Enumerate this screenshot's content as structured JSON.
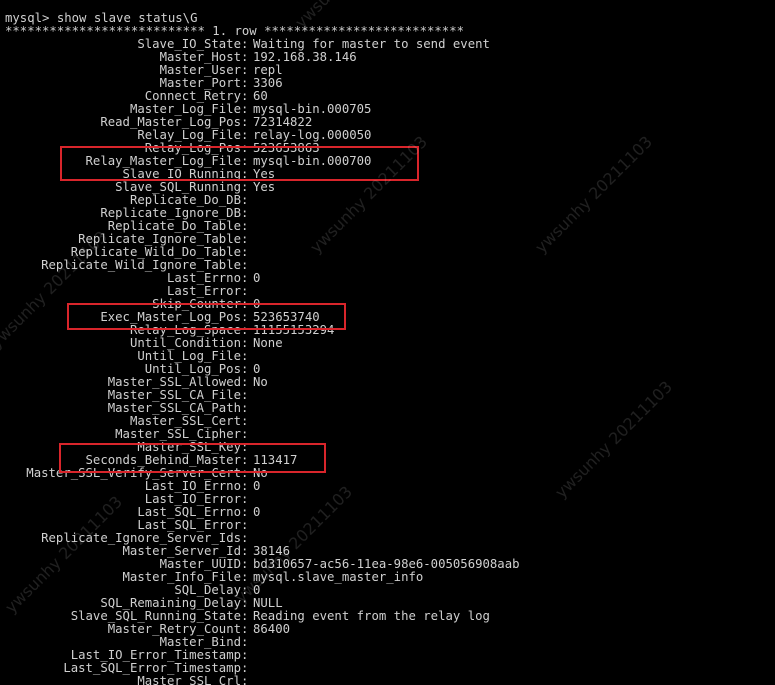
{
  "terminal": {
    "background": "#000000",
    "text_color": "#d0d0d0",
    "highlight_color": "#d9252b",
    "command_line": "mysql> show slave status\\G",
    "row_header": "*************************** 1. row ***************************",
    "fields": [
      {
        "name": "Slave_IO_State",
        "value": "Waiting for master to send event"
      },
      {
        "name": "Master_Host",
        "value": "192.168.38.146"
      },
      {
        "name": "Master_User",
        "value": "repl"
      },
      {
        "name": "Master_Port",
        "value": "3306"
      },
      {
        "name": "Connect_Retry",
        "value": "60"
      },
      {
        "name": "Master_Log_File",
        "value": "mysql-bin.000705"
      },
      {
        "name": "Read_Master_Log_Pos",
        "value": "72314822"
      },
      {
        "name": "Relay_Log_File",
        "value": "relay-log.000050"
      },
      {
        "name": "Relay_Log_Pos",
        "value": "523653863"
      },
      {
        "name": "Relay_Master_Log_File",
        "value": "mysql-bin.000700"
      },
      {
        "name": "Slave_IO_Running",
        "value": "Yes"
      },
      {
        "name": "Slave_SQL_Running",
        "value": "Yes"
      },
      {
        "name": "Replicate_Do_DB",
        "value": ""
      },
      {
        "name": "Replicate_Ignore_DB",
        "value": ""
      },
      {
        "name": "Replicate_Do_Table",
        "value": ""
      },
      {
        "name": "Replicate_Ignore_Table",
        "value": ""
      },
      {
        "name": "Replicate_Wild_Do_Table",
        "value": ""
      },
      {
        "name": "Replicate_Wild_Ignore_Table",
        "value": ""
      },
      {
        "name": "Last_Errno",
        "value": "0"
      },
      {
        "name": "Last_Error",
        "value": ""
      },
      {
        "name": "Skip_Counter",
        "value": "0"
      },
      {
        "name": "Exec_Master_Log_Pos",
        "value": "523653740"
      },
      {
        "name": "Relay_Log_Space",
        "value": "11155153294"
      },
      {
        "name": "Until_Condition",
        "value": "None"
      },
      {
        "name": "Until_Log_File",
        "value": ""
      },
      {
        "name": "Until_Log_Pos",
        "value": "0"
      },
      {
        "name": "Master_SSL_Allowed",
        "value": "No"
      },
      {
        "name": "Master_SSL_CA_File",
        "value": ""
      },
      {
        "name": "Master_SSL_CA_Path",
        "value": ""
      },
      {
        "name": "Master_SSL_Cert",
        "value": ""
      },
      {
        "name": "Master_SSL_Cipher",
        "value": ""
      },
      {
        "name": "Master_SSL_Key",
        "value": ""
      },
      {
        "name": "Seconds_Behind_Master",
        "value": "113417"
      },
      {
        "name": "Master_SSL_Verify_Server_Cert",
        "value": "No"
      },
      {
        "name": "Last_IO_Errno",
        "value": "0"
      },
      {
        "name": "Last_IO_Error",
        "value": ""
      },
      {
        "name": "Last_SQL_Errno",
        "value": "0"
      },
      {
        "name": "Last_SQL_Error",
        "value": ""
      },
      {
        "name": "Replicate_Ignore_Server_Ids",
        "value": ""
      },
      {
        "name": "Master_Server_Id",
        "value": "38146"
      },
      {
        "name": "Master_UUID",
        "value": "bd310657-ac56-11ea-98e6-005056908aab"
      },
      {
        "name": "Master_Info_File",
        "value": "mysql.slave_master_info"
      },
      {
        "name": "SQL_Delay",
        "value": "0"
      },
      {
        "name": "SQL_Remaining_Delay",
        "value": "NULL"
      },
      {
        "name": "Slave_SQL_Running_State",
        "value": "Reading event from the relay log"
      },
      {
        "name": "Master_Retry_Count",
        "value": "86400"
      },
      {
        "name": "Master_Bind",
        "value": ""
      },
      {
        "name": "Last_IO_Error_Timestamp",
        "value": ""
      },
      {
        "name": "Last_SQL_Error_Timestamp",
        "value": ""
      },
      {
        "name": "Master_SSL_Crl",
        "value": ""
      }
    ]
  },
  "watermark": {
    "text": "ywsunhy 20211103"
  }
}
